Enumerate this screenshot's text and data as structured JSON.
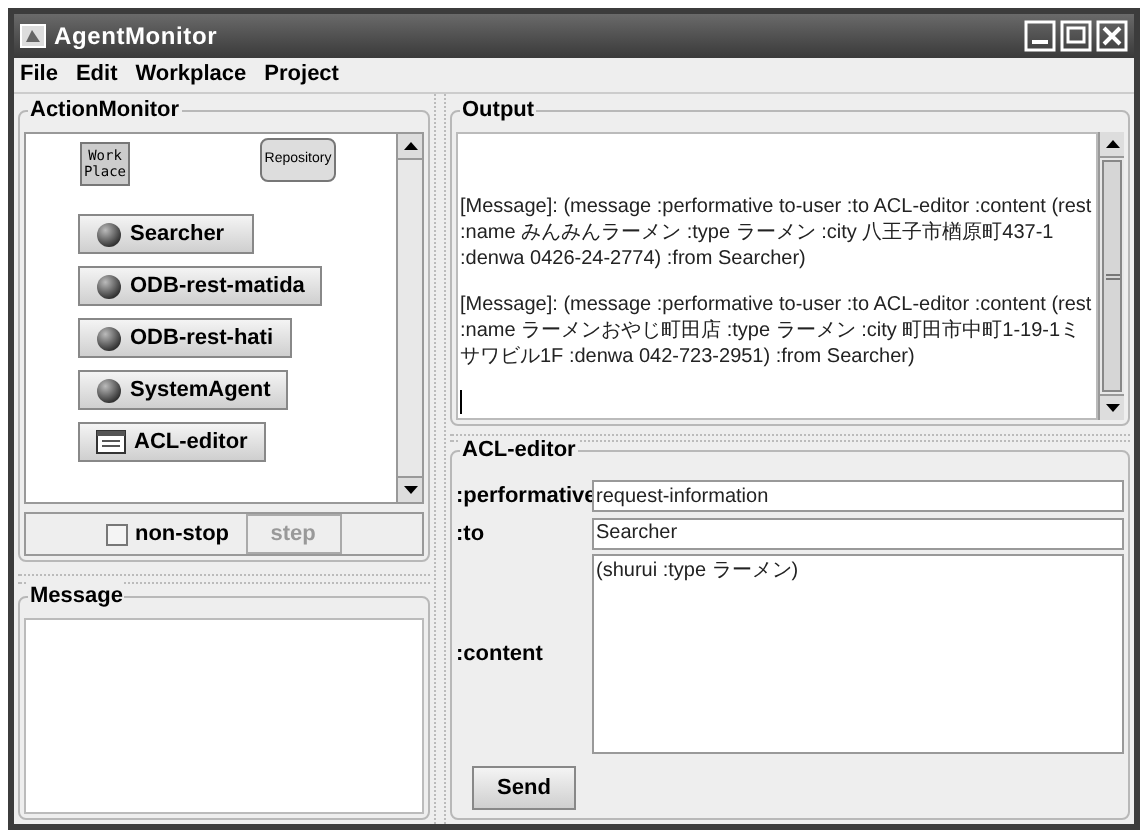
{
  "window": {
    "title": "AgentMonitor"
  },
  "menu": [
    "File",
    "Edit",
    "Workplace",
    "Project"
  ],
  "action_monitor": {
    "title": "ActionMonitor",
    "workplace": "Work Place",
    "repository": "Repository",
    "agents": [
      {
        "kind": "agent",
        "label": "Searcher"
      },
      {
        "kind": "agent",
        "label": "ODB-rest-matida"
      },
      {
        "kind": "agent",
        "label": "ODB-rest-hati"
      },
      {
        "kind": "agent",
        "label": "SystemAgent"
      },
      {
        "kind": "editor",
        "label": "ACL-editor"
      }
    ],
    "non_stop": {
      "label": "non-stop",
      "checked": false
    },
    "step": {
      "label": "step",
      "disabled": true
    }
  },
  "message": {
    "title": "Message"
  },
  "output": {
    "title": "Output",
    "messages": [
      "[Message]: (message :performative to-user :to ACL-editor :content (rest :name みんみんラーメン :type ラーメン :city 八王子市楢原町437-1 :denwa 0426-24-2774) :from Searcher)",
      "[Message]: (message :performative to-user :to ACL-editor :content (rest :name ラーメンおやじ町田店 :type ラーメン :city 町田市中町1-19-1ミサワビル1F :denwa 042-723-2951) :from Searcher)"
    ]
  },
  "acl_editor": {
    "title": "ACL-editor",
    "performative_label": ":performative",
    "performative": "request-information",
    "to_label": ":to",
    "to": "Searcher",
    "content_label": ":content",
    "content": "(shurui :type ラーメン)",
    "send": "Send"
  }
}
